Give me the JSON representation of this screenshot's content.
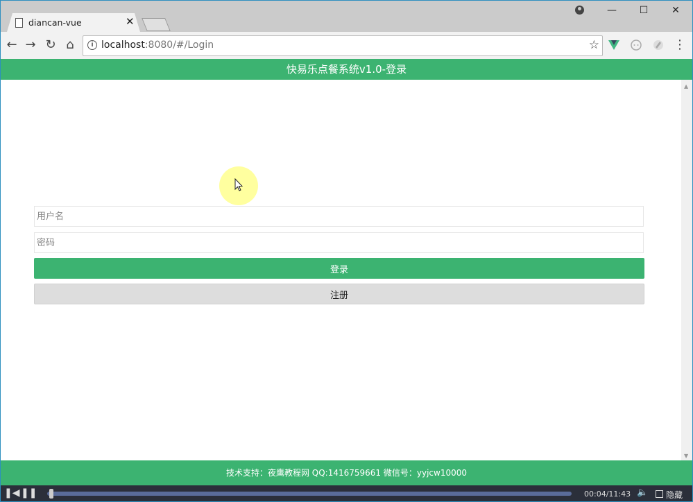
{
  "browser": {
    "tab_title": "diancan-vue",
    "tab_close": "✕",
    "url_host": "localhost",
    "url_rest": ":8080/#/Login",
    "win_minimize": "—",
    "win_maximize": "☐",
    "win_close": "✕"
  },
  "app": {
    "header_title": "快易乐点餐系统v1.0-登录",
    "footer_text": "技术支持：夜鹰教程网 QQ:1416759661 微信号：yyjcw10000"
  },
  "login_form": {
    "username_placeholder": "用户名",
    "password_placeholder": "密码",
    "login_label": "登录",
    "register_label": "注册"
  },
  "player": {
    "time": "00:04/11:43",
    "hide_label": "隐藏",
    "progress_fraction": 0.006
  },
  "colors": {
    "accent": "#3cb371",
    "chrome_bar": "#cbcbcb",
    "toolbar": "#f2f2f2"
  }
}
